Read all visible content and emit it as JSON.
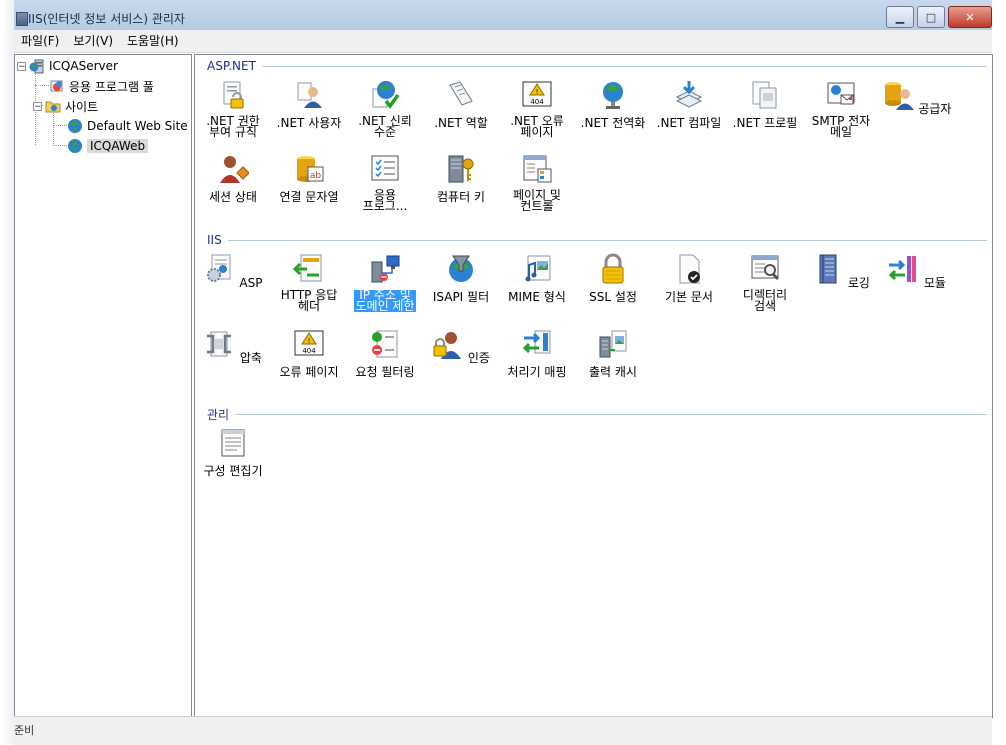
{
  "window": {
    "title": "IIS(인터넷 정보 서비스) 관리자"
  },
  "menu": {
    "items": [
      "파일(F)",
      "보기(V)",
      "도움말(H)"
    ]
  },
  "tree": {
    "server": "ICQAServer",
    "app_pools": "응용 프로그램 풀",
    "sites": "사이트",
    "site1": "Default Web Site",
    "site2": "ICQAWeb"
  },
  "groups": {
    "aspnet": {
      "title": "ASP.NET",
      "items": [
        ".NET 권한\n부여 규칙",
        ".NET 사용자",
        ".NET 신뢰\n수준",
        ".NET 역할",
        ".NET 오류\n페이지",
        ".NET 전역화",
        ".NET 컴파일",
        ".NET 프로필",
        "SMTP 전자\n메일",
        "공급자",
        "세션 상태",
        "연결 문자열",
        "응용\n프로그...",
        "컴퓨터 키",
        "페이지 및\n컨트롤"
      ]
    },
    "iis": {
      "title": "IIS",
      "items": [
        "ASP",
        "HTTP 응답\n헤더",
        "IP 주소 및\n도메인 제한",
        "ISAPI 필터",
        "MIME 형식",
        "SSL 설정",
        "기본 문서",
        "디렉터리\n검색",
        "로깅",
        "모듈",
        "압축",
        "오류 페이지",
        "요청 필터링",
        "인증",
        "처리기 매핑",
        "출력 캐시"
      ]
    },
    "management": {
      "title": "관리",
      "items": [
        "구성 편집기"
      ]
    }
  },
  "selected_feature": "IP 주소 및\n도메인 제한",
  "status": {
    "text": "준비"
  }
}
